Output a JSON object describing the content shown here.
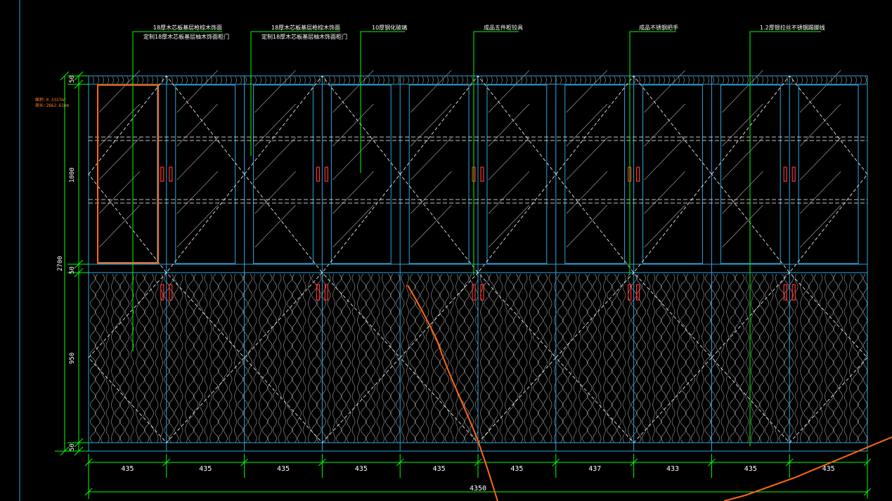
{
  "drawing": {
    "annotations": [
      {
        "id": "ann-wood-veneer-1",
        "lines": [
          "18厚木芯板基层枪棕木饰面",
          "定制18厚木芯板基层柚木饰面柜门"
        ]
      },
      {
        "id": "ann-wood-veneer-2",
        "lines": [
          "18厚木芯板基层枪棕木饰面",
          "定制18厚木芯板基层柚木饰面柜门"
        ]
      },
      {
        "id": "ann-glass",
        "lines": [
          "10厚钢化玻璃"
        ]
      },
      {
        "id": "ann-hardware",
        "lines": [
          "成品五件柜铰具"
        ]
      },
      {
        "id": "ann-handle",
        "lines": [
          "成品不锈钢把手"
        ]
      },
      {
        "id": "ann-trim",
        "lines": [
          "1.2厚银拉丝不锈钢踢脚线"
        ]
      }
    ],
    "selection_info": [
      "面积:0.3337m²",
      "周长:2662.61mm"
    ],
    "vertical_dims": {
      "top_strip": "50",
      "upper": "1000",
      "mid_strip": "50",
      "lower": "950",
      "bottom_strip": "50",
      "total": "2700"
    },
    "horizontal_dims": [
      "435",
      "435",
      "435",
      "435",
      "435",
      "435",
      "437",
      "433",
      "435",
      "435"
    ],
    "overall_width": "4350",
    "colors": {
      "background": "#000000",
      "frame": "#2aa8e0",
      "dim_lines": "#00ff00",
      "hatch": "#ffffff",
      "selection": "#ff6a10",
      "handles": "#ff3030"
    }
  }
}
